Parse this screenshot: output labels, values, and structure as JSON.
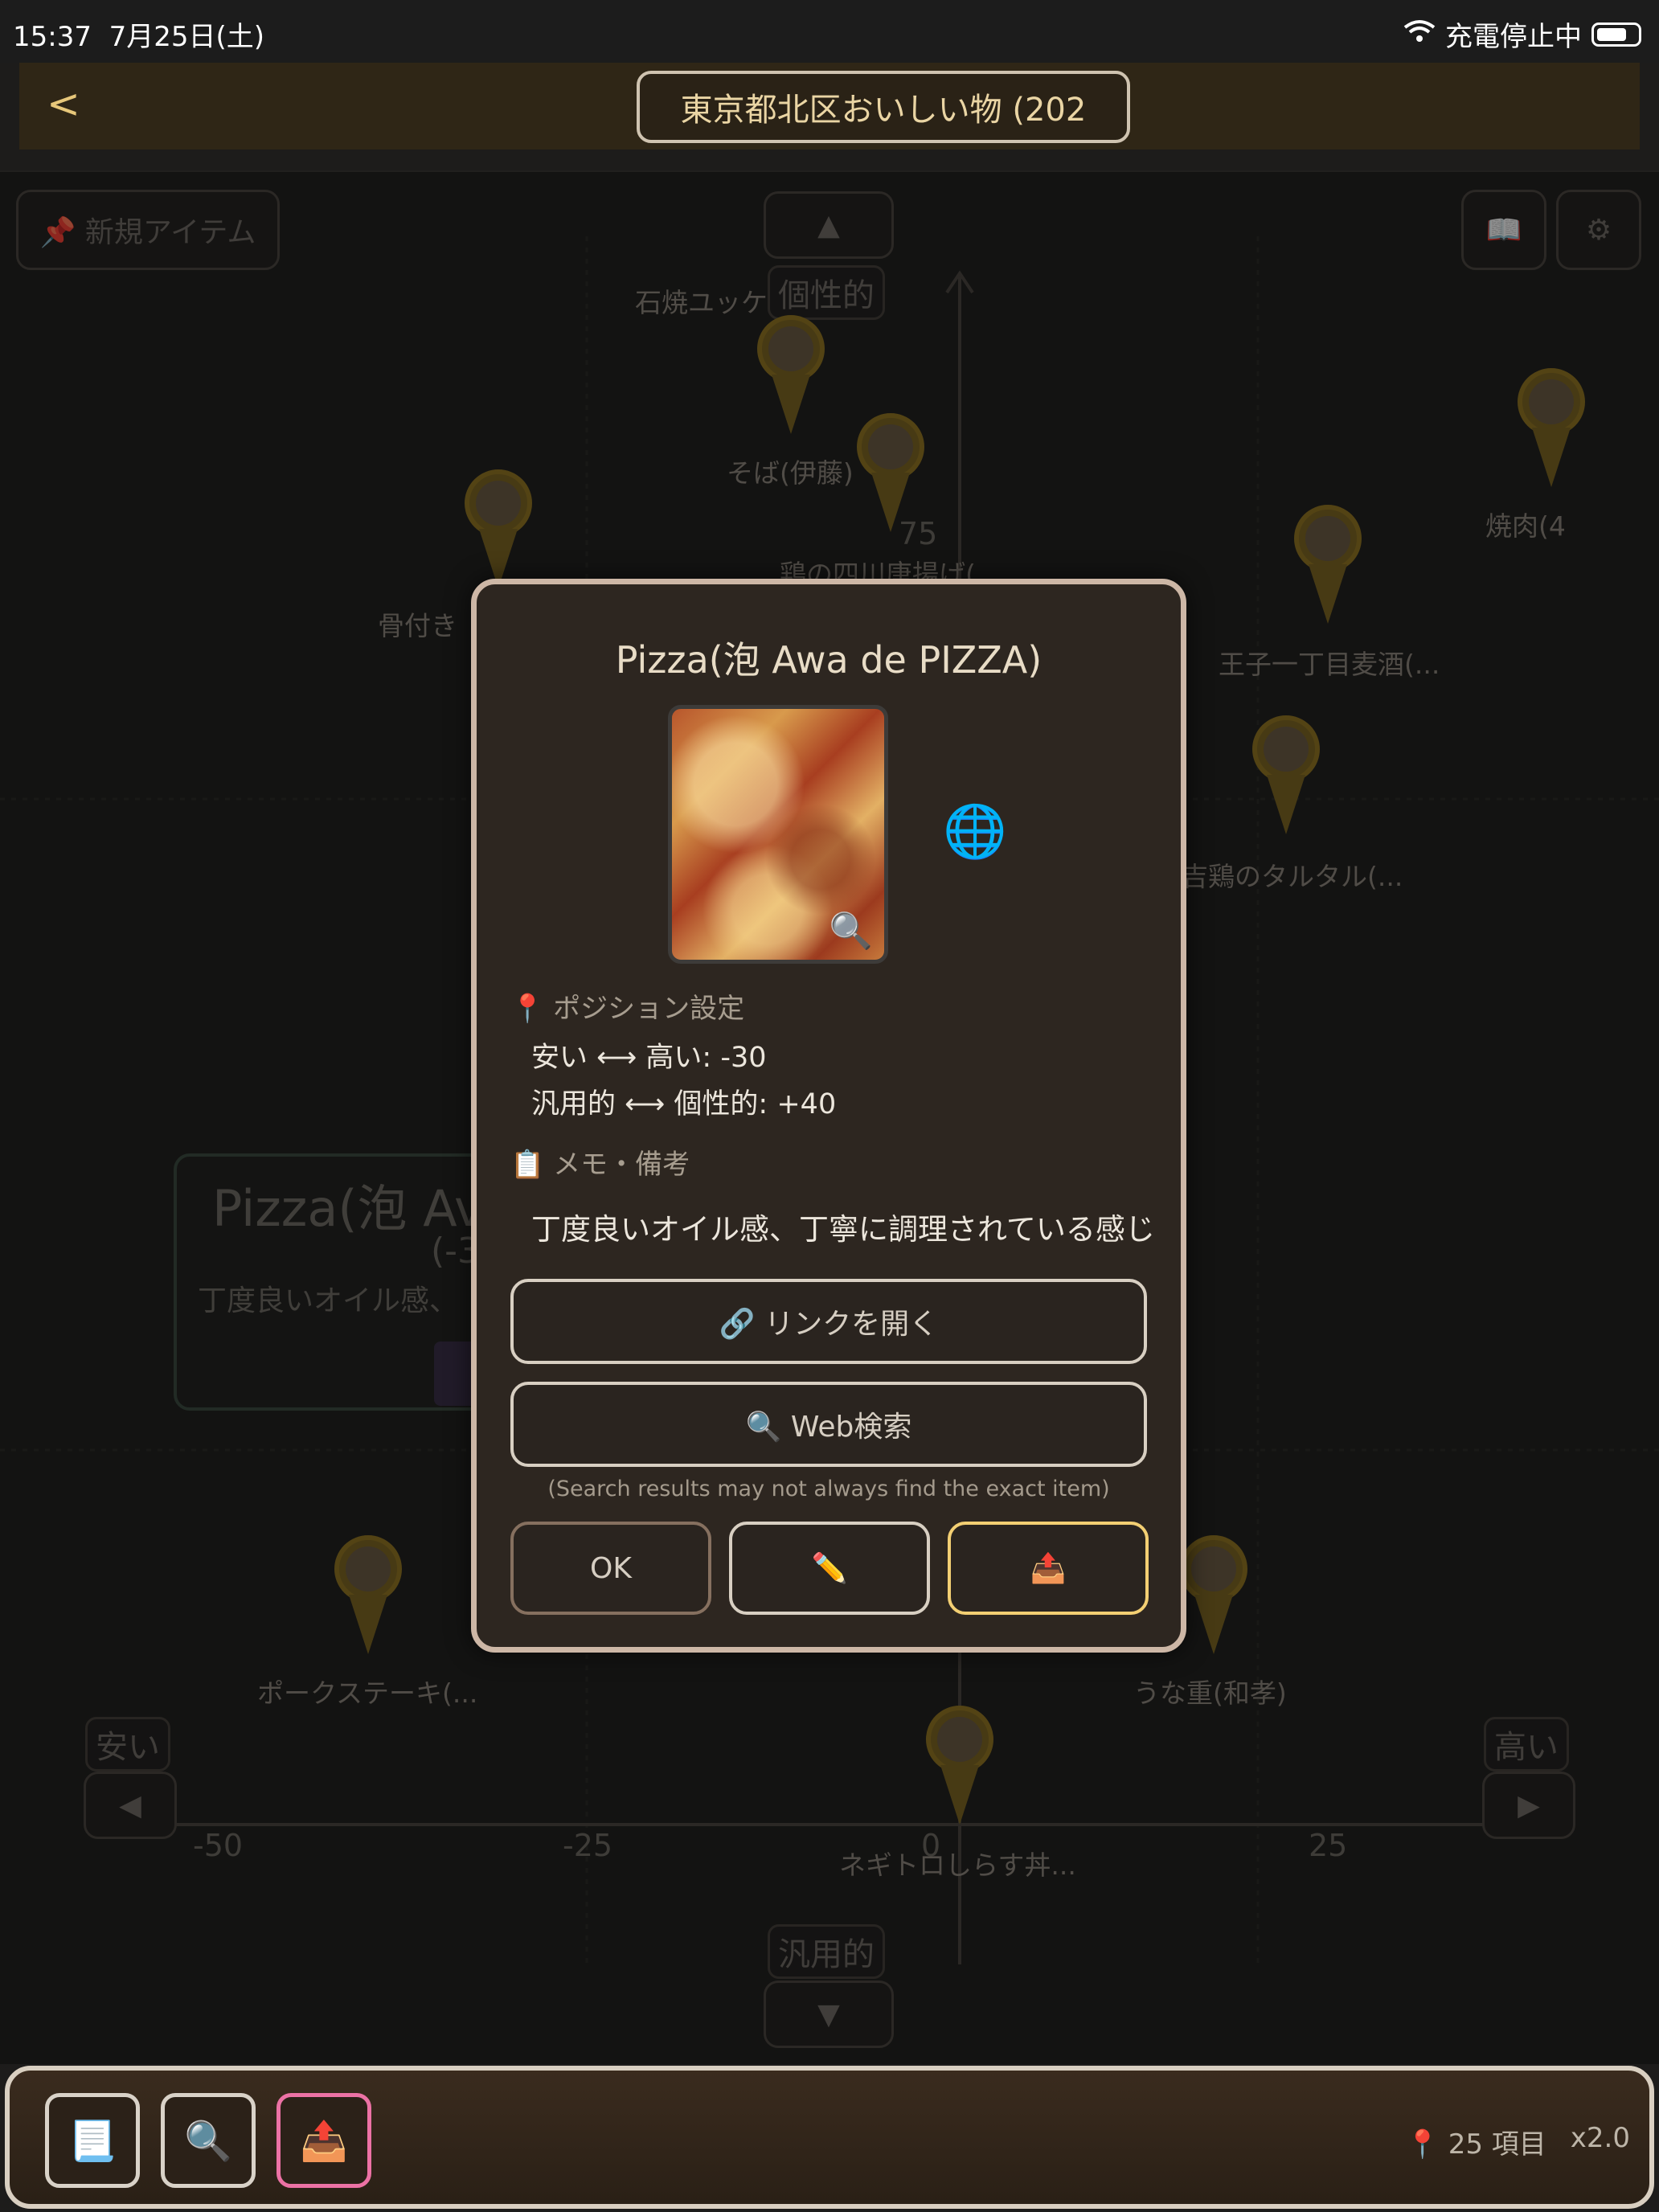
{
  "status_bar": {
    "time": "15:37",
    "date": "7月25日(土)",
    "charging": "充電停止中"
  },
  "header": {
    "back": "<",
    "title": "東京都北区おいしい物 (202"
  },
  "map": {
    "new_item_button": "📌 新規アイテム",
    "book_icon": "📖",
    "gear_icon": "⚙",
    "up_arrow": "▲",
    "down_arrow": "▼",
    "left_arrow": "◀",
    "right_arrow": "▶",
    "y_top_label": "個性的",
    "y_bottom_label": "汎用的",
    "x_left_label": "安い",
    "x_right_label": "高い",
    "ticks": {
      "x": [
        "-50",
        "-25",
        "0",
        "25"
      ],
      "y": [
        "75"
      ]
    },
    "pins": [
      {
        "label": "石焼ユッケ"
      },
      {
        "label": "そば(伊藤)"
      },
      {
        "label": "鶏の四川唐揚げ(..."
      },
      {
        "label": "骨付き"
      },
      {
        "label": "王子一丁目麦酒(..."
      },
      {
        "label": "焼肉(4"
      },
      {
        "label": "吉鶏のタルタル(..."
      },
      {
        "label": "ポークステーキ(..."
      },
      {
        "label": "うな重(和孝)"
      },
      {
        "label": "ネギトロしらす丼..."
      }
    ],
    "ghost_card": {
      "title": "Pizza(泡 Av",
      "sub": "(-3",
      "memo": "丁度良いオイル感、"
    }
  },
  "modal": {
    "title": "Pizza(泡 Awa de PIZZA)",
    "magnify_icon": "🔍",
    "globe_icon": "🌐",
    "position_header": "📍 ポジション設定",
    "x_value": "安い ⟷ 高い: -30",
    "y_value": "汎用的 ⟷ 個性的: +40",
    "memo_header": "📋 メモ・備考",
    "memo": "丁度良いオイル感、丁寧に調理されている感じ",
    "link_button": "🔗 リンクを開く",
    "search_button": "🔍 Web検索",
    "search_note": "(Search results may not always find the exact item)",
    "ok_button": "OK",
    "edit_button": "✏️",
    "share_button": "📤"
  },
  "bottom_bar": {
    "list_icon": "📃",
    "search_icon": "🔍",
    "share_icon": "📤",
    "count": "📍 25 項目",
    "zoom": "x2.0"
  }
}
